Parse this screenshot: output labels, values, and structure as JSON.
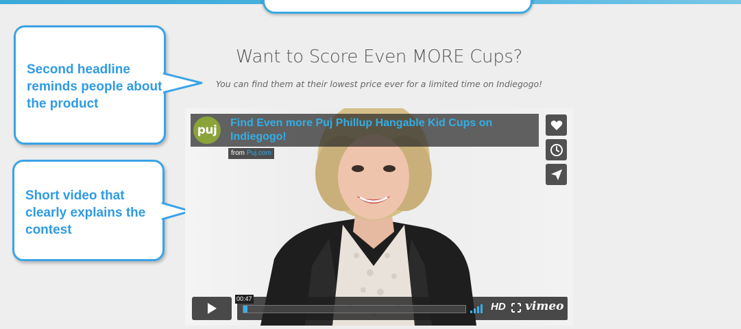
{
  "headline": "Want to Score Even MORE Cups?",
  "subtitle": "You can find them at their lowest price ever for a limited time on Indiegogo!",
  "callouts": [
    {
      "text": "Second headline reminds people about the product"
    },
    {
      "text": "Short video that clearly explains the contest"
    }
  ],
  "video": {
    "logo_text": "puj",
    "title": "Find Even more Puj Phillup Hangable Kid Cups on Indiegogo!",
    "from_prefix": "from ",
    "from_link": "Puj.com",
    "time": "00:47",
    "progress": 0.02,
    "hd_label": "HD",
    "brand": "vimeo",
    "side_icons": [
      "heart-icon",
      "clock-icon",
      "send-icon"
    ]
  },
  "colors": {
    "accent": "#3aa3e6",
    "callout_text": "#2f9be3",
    "video_title": "#33aee6",
    "background": "#eeeeee"
  }
}
